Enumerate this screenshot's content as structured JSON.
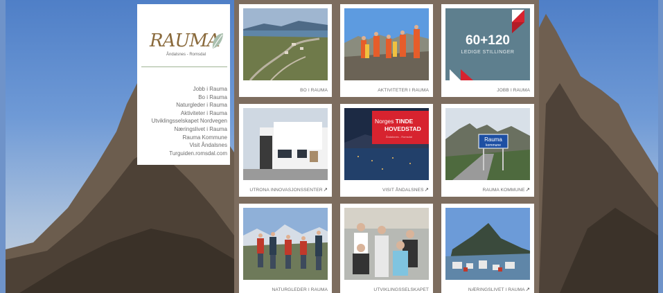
{
  "brand": {
    "logo_text": "RAUMA",
    "logo_subtitle": "Åndalsnes - Romsdal"
  },
  "menu": {
    "items": [
      {
        "label": "Jobb i Rauma"
      },
      {
        "label": "Bo i Rauma"
      },
      {
        "label": "Naturgleder i Rauma"
      },
      {
        "label": "Aktiviteter i Rauma"
      },
      {
        "label": "Utviklingsselskapet Nordvegen"
      },
      {
        "label": "Næringslivet i Rauma"
      },
      {
        "label": "Rauma Kommune"
      },
      {
        "label": "Visit Åndalsnes"
      },
      {
        "label": "Turguiden.romsdal.com"
      }
    ]
  },
  "tiles": [
    {
      "caption": "BO I RAUMA",
      "external": false
    },
    {
      "caption": "AKTIVITETER I RAUMA",
      "external": false
    },
    {
      "caption": "JOBB I RAUMA",
      "external": false
    },
    {
      "caption": "UTRONA INNOVASJONSSENTER",
      "external": true
    },
    {
      "caption": "VISIT ÅNDALSNES",
      "external": true
    },
    {
      "caption": "RAUMA KOMMUNE",
      "external": true
    },
    {
      "caption": "NATURGLEDER I RAUMA",
      "external": false
    },
    {
      "caption": "UTVIKLINGSSELSKAPET",
      "external": false
    },
    {
      "caption": "NÆRINGSLIVET I RAUMA",
      "external": true
    }
  ],
  "jobs_tile": {
    "headline": "60+120",
    "subline": "LEDIGE STILLINGER"
  },
  "visit_tile": {
    "line1_a": "Norges",
    "line1_b": "TINDE",
    "line2": "HOVEDSTAD",
    "line3": "Åndalsnes - Romsdal"
  },
  "road_sign": {
    "text": "Rauma",
    "subtext": "kommune"
  },
  "external_link_icon": "↗",
  "colors": {
    "menu_text": "#6b6b6b",
    "jobs_bg": "#5e7f8e",
    "tinde_red": "#d7232f",
    "divider_green": "#9fb594"
  }
}
